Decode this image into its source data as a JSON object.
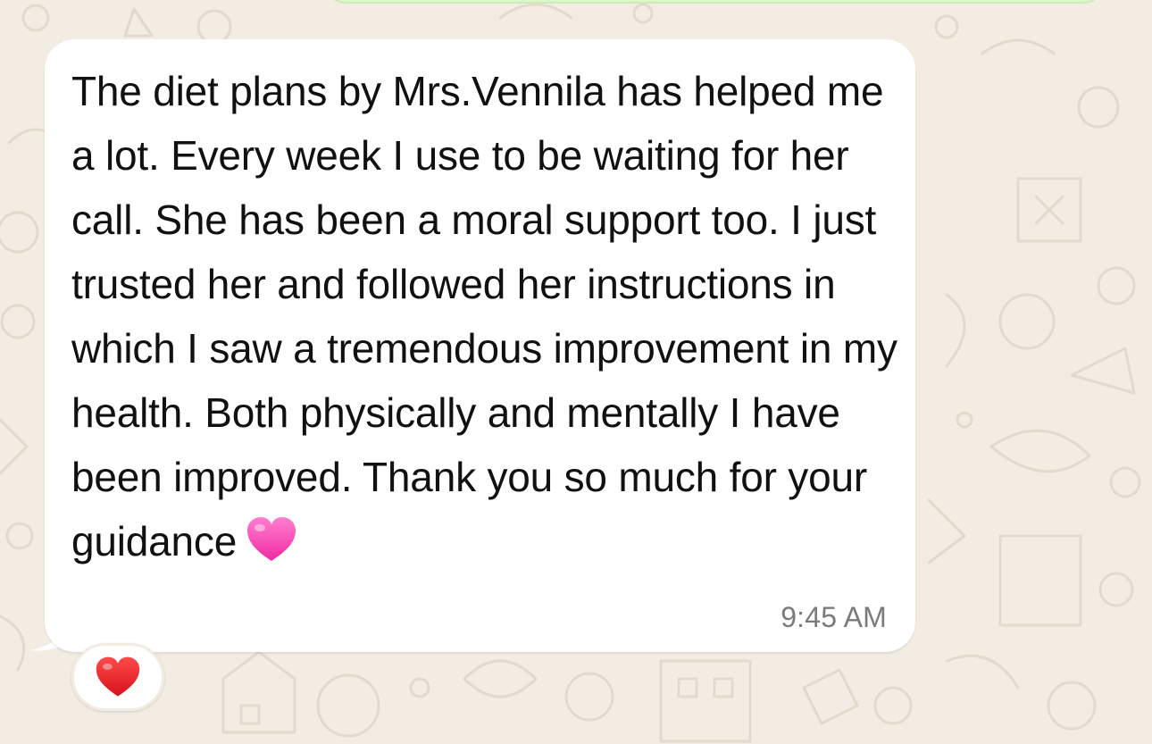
{
  "chat": {
    "message": {
      "text": "The diet plans by Mrs.Vennila has helped me a lot. Every week I use to be waiting for her call. She has been a moral support too. I just trusted her and followed her instructions in which I saw a tremendous improvement in my health. Both physically and mentally I have been improved. Thank you so much for your guidance",
      "emoji": "pink-heart-icon",
      "time": "9:45 AM"
    },
    "reaction": {
      "emoji": "red-heart-icon"
    }
  },
  "colors": {
    "wallpaper": "#f2ece3",
    "bubble": "#ffffff",
    "outgoing_bubble": "#dcf8c6",
    "timestamp": "#7b7b7b",
    "pink_heart": "#ff4fb8",
    "red_heart": "#e8202a"
  }
}
